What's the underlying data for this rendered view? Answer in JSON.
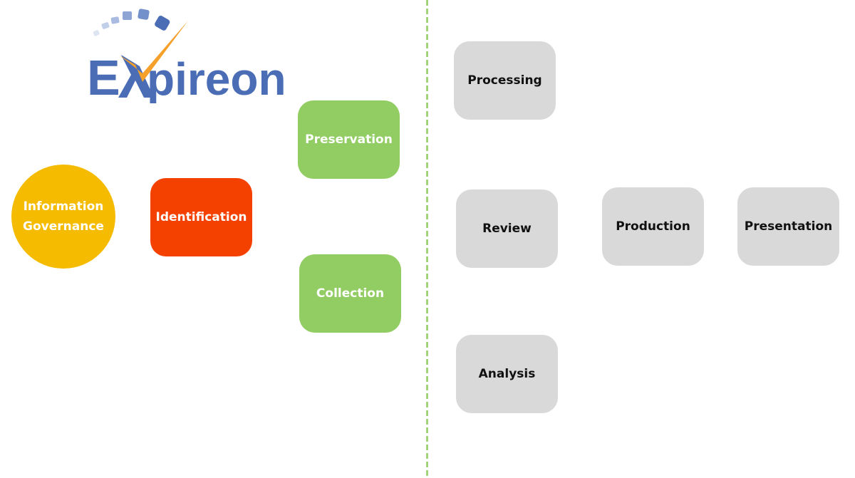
{
  "logo": {
    "text": "Expireon",
    "colors": {
      "blue": "#4a6db5",
      "orange": "#f5a02a"
    }
  },
  "divider": {
    "color": "#92cd63",
    "style": "dashed"
  },
  "nodes": {
    "information_governance": {
      "line1": "Information",
      "line2": "Governance",
      "color": "#f4bb00"
    },
    "identification": {
      "label": "Identification",
      "color": "#f54100"
    },
    "preservation": {
      "label": "Preservation",
      "color": "#92cd63"
    },
    "collection": {
      "label": "Collection",
      "color": "#92cd63"
    },
    "processing": {
      "label": "Processing",
      "color": "#d9d9d9"
    },
    "review": {
      "label": "Review",
      "color": "#d9d9d9"
    },
    "analysis": {
      "label": "Analysis",
      "color": "#d9d9d9"
    },
    "production": {
      "label": "Production",
      "color": "#d9d9d9"
    },
    "presentation": {
      "label": "Presentation",
      "color": "#d9d9d9"
    }
  }
}
